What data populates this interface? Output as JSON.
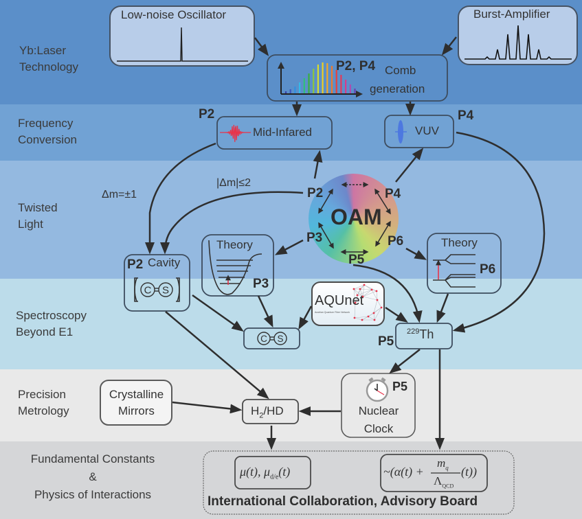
{
  "colors": {
    "band_laser": "#5b8fc9",
    "band_frequency": "#71a2d4",
    "band_twisted": "#94b9e0",
    "band_spectroscopy": "#bcdcea",
    "band_metrology": "#e9e9e9",
    "band_fundamental": "#d5d6d8",
    "arrow": "#2e2e2e",
    "accent_red": "#e8334a",
    "accent_blue": "#3f6fe0"
  },
  "bands": [
    {
      "id": "laser",
      "lines": [
        "Yb:Laser",
        "Technology"
      ]
    },
    {
      "id": "frequency",
      "lines": [
        "Frequency",
        "Conversion"
      ]
    },
    {
      "id": "twisted",
      "lines": [
        "Twisted",
        "Light"
      ]
    },
    {
      "id": "spectroscopy",
      "lines": [
        "Spectroscopy",
        "Beyond E1"
      ]
    },
    {
      "id": "metrology",
      "lines": [
        "Precision",
        "Metrology"
      ]
    },
    {
      "id": "fundamental",
      "lines": [
        "Fundamental Constants",
        "&",
        "Physics of Interactions"
      ]
    }
  ],
  "nodes": {
    "oscillator": {
      "label": "Low-noise Oscillator"
    },
    "burst_amplifier": {
      "label": "Burst-Amplifier"
    },
    "comb": {
      "projects": "P2, P4",
      "label_line1": "Comb",
      "label_line2": "generation"
    },
    "mid_infrared": {
      "project": "P2",
      "label": "Mid-Infared"
    },
    "vuv": {
      "project": "P4",
      "label": "VUV"
    },
    "oam": {
      "label": "OAM",
      "projects": [
        "P2",
        "P4",
        "P3",
        "P6",
        "P5"
      ]
    },
    "cavity": {
      "project": "P2",
      "label": "Cavity",
      "molecule": "C=S"
    },
    "theory_p3": {
      "label": "Theory",
      "project": "P3"
    },
    "theory_p6": {
      "label": "Theory",
      "project": "P6"
    },
    "cs_molecule": {
      "left": "C",
      "right": "S"
    },
    "aqunet": {
      "label": "AQUnet",
      "sublabel": "Austrian Quantum Fiber Network"
    },
    "thorium": {
      "project": "P5",
      "mass": "229",
      "element": "Th"
    },
    "crystalline_mirrors": {
      "line1": "Crystalline",
      "line2": "Mirrors"
    },
    "h2hd": {
      "prefix": "H",
      "sub": "2",
      "suffix": "/HD"
    },
    "nuclear_clock": {
      "project": "P5",
      "line1": "Nuclear",
      "line2": "Clock"
    },
    "mu_formula": {
      "text": "μ(t), μ",
      "sub": "d/e",
      "tail": "(t)"
    },
    "alpha_formula": {
      "prefix": "~(α(t) +",
      "num": "m",
      "num_sub": "q",
      "den": "Λ",
      "den_sub": "QCD",
      "tail": "(t))"
    },
    "collaboration": {
      "label": "International Collaboration, Advisory Board"
    }
  },
  "edge_labels": {
    "delta_m_1": "Δm=±1",
    "delta_m_2": "|Δm|≤2"
  }
}
